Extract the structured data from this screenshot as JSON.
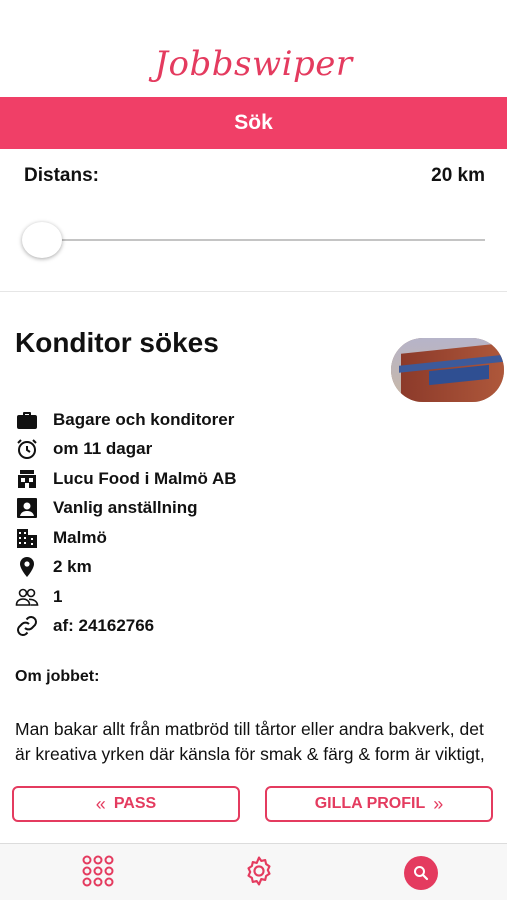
{
  "app": {
    "title": "Jobbswiper"
  },
  "header": {
    "label": "Sök"
  },
  "filter": {
    "distance_label": "Distans:",
    "distance_value": "20 km",
    "slider_fraction": 0.0
  },
  "job": {
    "title": "Konditor sökes",
    "details": [
      {
        "icon": "briefcase-icon",
        "text": "Bagare och konditorer"
      },
      {
        "icon": "alarm-clock-icon",
        "text": "om 11 dagar"
      },
      {
        "icon": "store-icon",
        "text": "Lucu Food i Malmö AB"
      },
      {
        "icon": "contact-card-icon",
        "text": "Vanlig anställning"
      },
      {
        "icon": "city-icon",
        "text": "Malmö"
      },
      {
        "icon": "location-pin-icon",
        "text": "2 km"
      },
      {
        "icon": "people-icon",
        "text": "1"
      },
      {
        "icon": "link-icon",
        "text": "af: 24162766"
      }
    ],
    "about_heading": "Om jobbet:",
    "about_text": "Man bakar allt från matbröd till tårtor eller andra bakverk, det är kreativa yrken där känsla för smak & färg & form är viktigt,"
  },
  "actions": {
    "pass_label": "PASS",
    "like_label": "GILLA PROFIL"
  },
  "colors": {
    "accent": "#e43b5f",
    "bar": "#f03f67"
  }
}
